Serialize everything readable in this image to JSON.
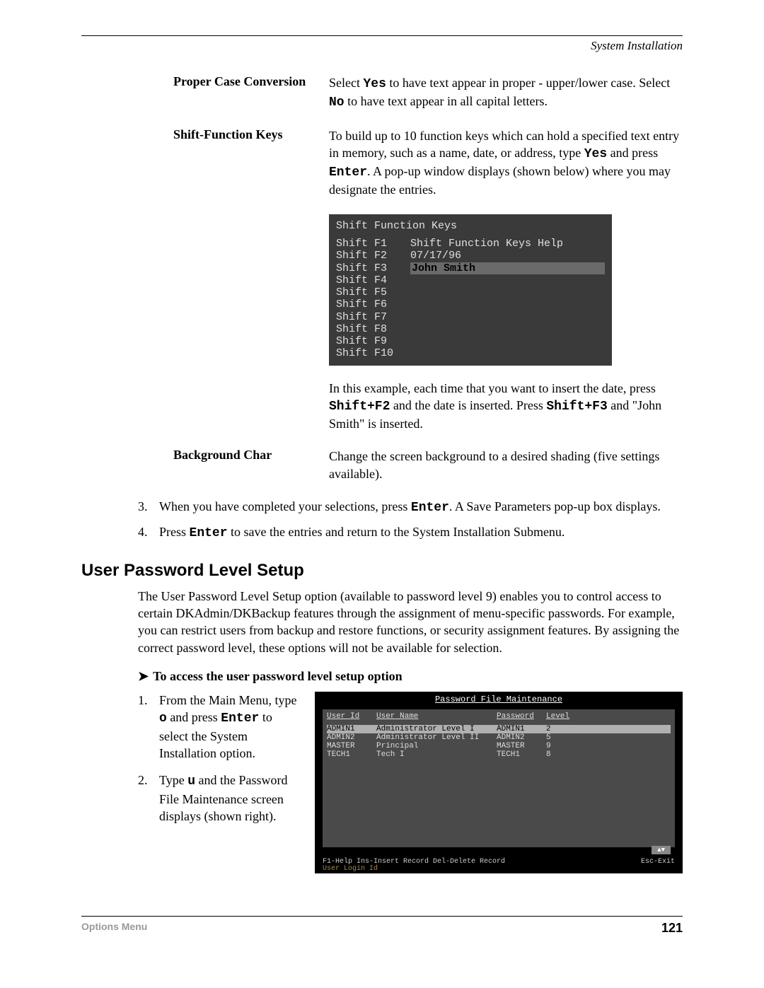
{
  "header": {
    "section": "System Installation"
  },
  "defs": {
    "proper_case": {
      "term": "Proper Case Conversion",
      "desc_a": "Select ",
      "yes": "Yes",
      "desc_b": " to have text appear in proper - upper/lower case. Select ",
      "no": "No",
      "desc_c": " to have text appear in all capital letters."
    },
    "shift_keys": {
      "term": "Shift-Function Keys",
      "desc_a": "To build up to 10 function keys which can hold a specified text entry in memory, such as a name, date, or address, type ",
      "yes": "Yes",
      "desc_b": " and press ",
      "enter": "Enter",
      "desc_c": ". A pop-up window displays (shown below) where you may designate the entries."
    },
    "example": {
      "desc_a": "In this example, each time that you want to insert the date, press ",
      "sf2": "Shift+F2",
      "desc_b": " and the date is inserted. Press ",
      "sf3": "Shift+F3",
      "desc_c": " and \"John Smith\" is inserted."
    },
    "bg": {
      "term": "Background Char",
      "desc": "Change the screen background to a desired shading (five settings available)."
    }
  },
  "shiftbox": {
    "title": "Shift Function Keys",
    "rows": [
      {
        "key": "Shift F1",
        "val": "Shift Function Keys Help"
      },
      {
        "key": "Shift F2",
        "val": "07/17/96"
      },
      {
        "key": "Shift F3",
        "val": "John Smith"
      },
      {
        "key": "Shift F4",
        "val": ""
      },
      {
        "key": "Shift F5",
        "val": ""
      },
      {
        "key": "Shift F6",
        "val": ""
      },
      {
        "key": "Shift F7",
        "val": ""
      },
      {
        "key": "Shift F8",
        "val": ""
      },
      {
        "key": "Shift F9",
        "val": ""
      },
      {
        "key": "Shift F10",
        "val": ""
      }
    ]
  },
  "steps_a": {
    "s3": {
      "num": "3.",
      "a": "When you have completed your selections, press ",
      "enter": "Enter",
      "b": ". A Save Parameters pop-up box displays."
    },
    "s4": {
      "num": "4.",
      "a": "Press ",
      "enter": "Enter",
      "b": " to save the entries and return to the System Installation Submenu."
    }
  },
  "section": {
    "title": "User Password Level Setup",
    "para": "The User Password Level Setup option (available to password level 9) enables you to control access to certain DKAdmin/DKBackup features through the assignment of menu-specific passwords. For example, you can restrict users from backup and restore functions, or security assignment features. By assigning the correct password level, these options will not be available for selection."
  },
  "arrow": {
    "glyph": "➤",
    "text": "To access the user password level setup option"
  },
  "steps_b": {
    "s1": {
      "num": "1.",
      "a": "From the Main Menu, type ",
      "o": "o",
      "b": " and press ",
      "enter": "Enter",
      "c": " to select the System Installation option."
    },
    "s2": {
      "num": "2.",
      "a": "Type ",
      "u": "u",
      "b": " and the Password File Maintenance screen displays (shown right)."
    }
  },
  "pwd": {
    "title": "Password File Maintenance",
    "head": {
      "userid": "User Id",
      "username": "User Name",
      "pwd": "Password",
      "lvl": "Level"
    },
    "rows": [
      {
        "userid": "ADMIN1",
        "username": "Administrator Level I",
        "pwd": "ADMIN1",
        "lvl": "2",
        "hi": true
      },
      {
        "userid": "ADMIN2",
        "username": "Administrator Level II",
        "pwd": "ADMIN2",
        "lvl": "5",
        "hi": false
      },
      {
        "userid": "MASTER",
        "username": "Principal",
        "pwd": "MASTER",
        "lvl": "9",
        "hi": false
      },
      {
        "userid": "TECH1",
        "username": "Tech I",
        "pwd": "TECH1",
        "lvl": "8",
        "hi": false
      }
    ],
    "arrow": "▲▼",
    "status_left": "F1-Help   Ins-Insert Record   Del-Delete Record",
    "status_right": "Esc-Exit",
    "login": "User Login Id"
  },
  "footer": {
    "left": "Options Menu",
    "right": "121"
  }
}
